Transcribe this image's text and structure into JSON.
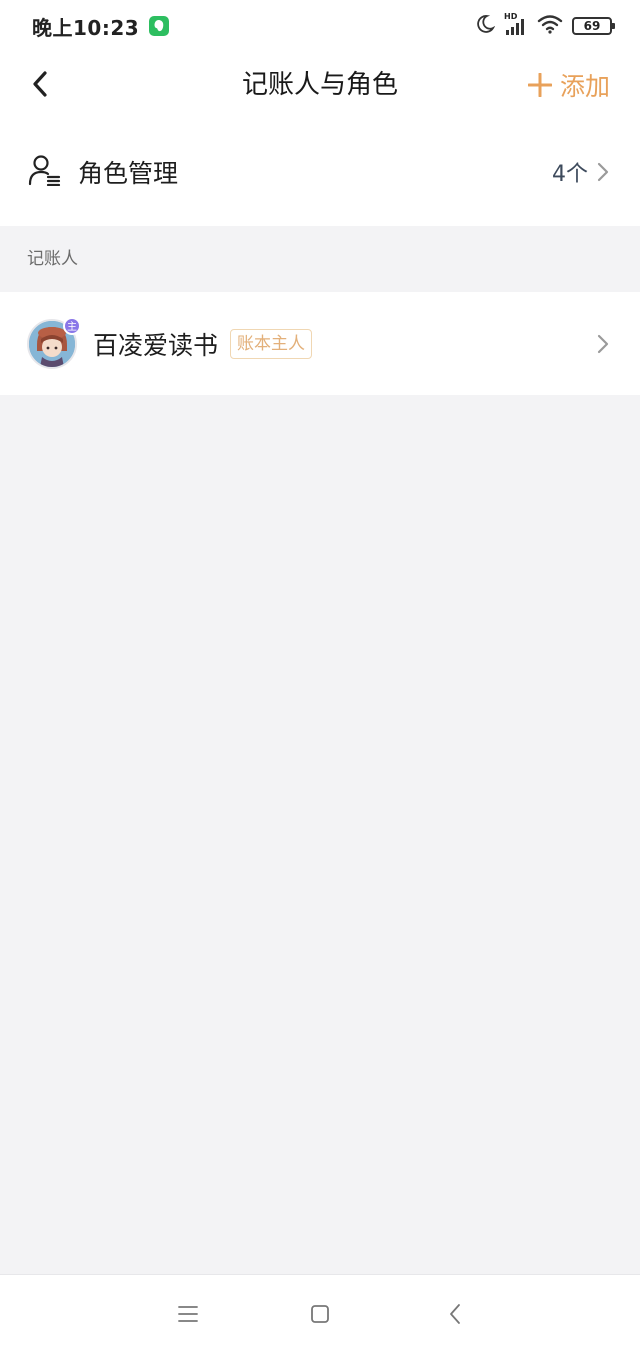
{
  "status_bar": {
    "time": "晚上10:23",
    "battery": "69",
    "network": "HD",
    "icons": [
      "evernote-icon",
      "moon-icon",
      "signal-icon",
      "wifi-icon",
      "battery-icon"
    ]
  },
  "nav": {
    "title": "记账人与角色",
    "add_label": "添加",
    "accent_color": "#e8a15a"
  },
  "role_management": {
    "label": "角色管理",
    "count": "4个"
  },
  "section": {
    "title": "记账人"
  },
  "members": [
    {
      "name": "百凌爱读书",
      "tag": "账本主人",
      "badge": "主"
    }
  ],
  "system_nav": {
    "icons": [
      "menu-icon",
      "home-icon",
      "back-icon"
    ]
  }
}
